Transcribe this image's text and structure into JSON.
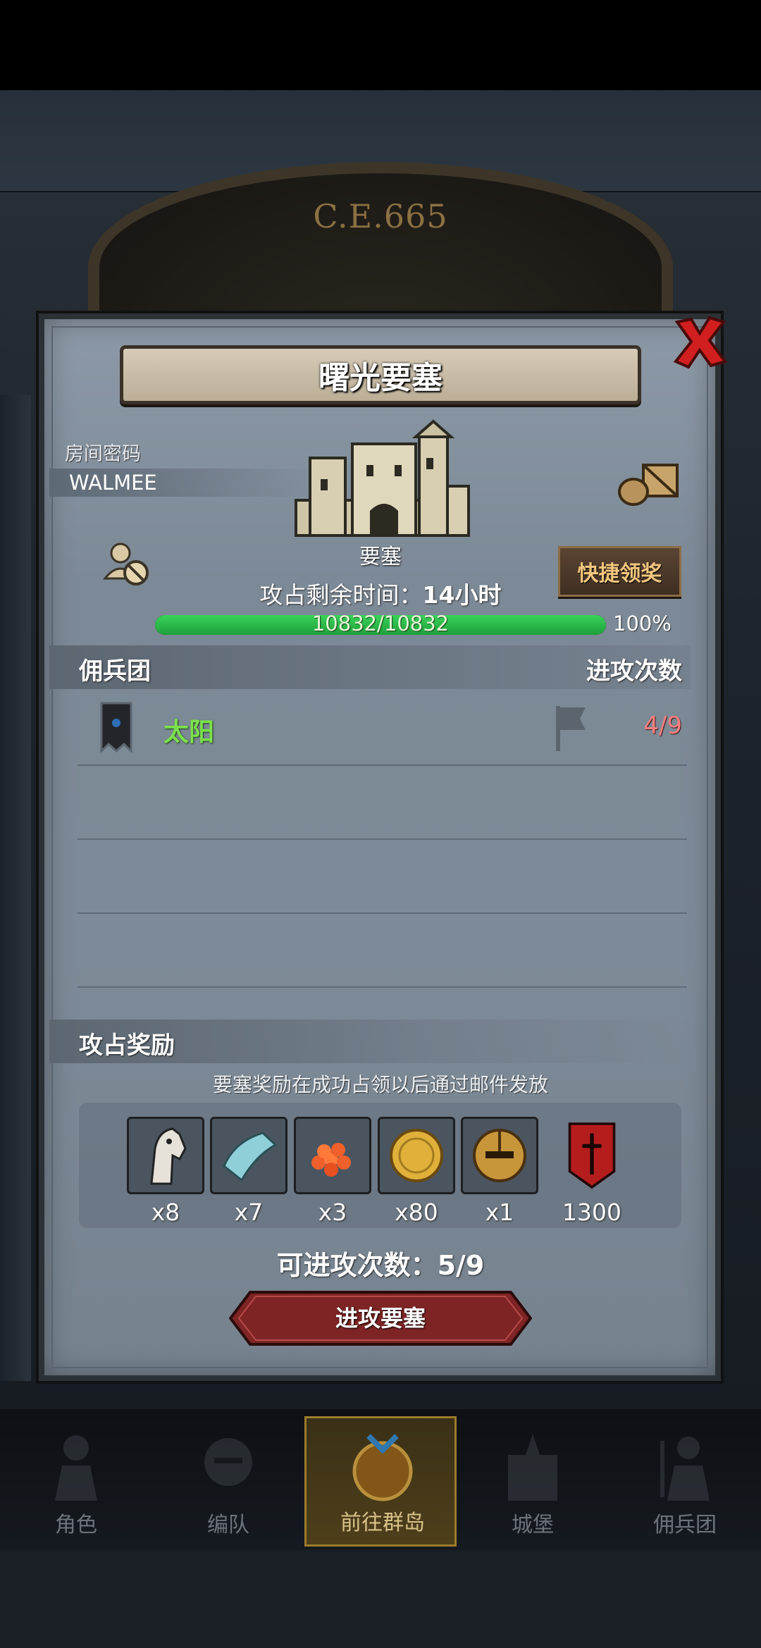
{
  "background": {
    "era_label": "C.E.665"
  },
  "modal": {
    "title": "曙光要塞",
    "room_password_label": "房间密码",
    "room_password": "WALMEE",
    "fortress_label": "要塞",
    "quick_claim": "快捷领奖",
    "timer_label": "攻占剩余时间：",
    "timer_value": "14小时",
    "hp_text": "10832/10832",
    "hp_percent": "100%",
    "hp_fraction": 1.0,
    "mercenary_header": "佣兵团",
    "attack_count_header": "进攻次数",
    "mercenaries": [
      {
        "name": "太阳",
        "count": "4/9"
      }
    ],
    "reward_header": "攻占奖励",
    "reward_note": "要塞奖励在成功占领以后通过邮件发放",
    "rewards": [
      {
        "icon": "horse-icon",
        "qty": "x8"
      },
      {
        "icon": "cloth-icon",
        "qty": "x7"
      },
      {
        "icon": "berries-icon",
        "qty": "x3"
      },
      {
        "icon": "gold-coin-icon",
        "qty": "x80"
      },
      {
        "icon": "helmet-icon",
        "qty": "x1"
      },
      {
        "icon": "red-banner-icon",
        "qty": "1300"
      }
    ],
    "attacks_left": "可进攻次数：5/9",
    "attack_button": "进攻要塞"
  },
  "nav": {
    "items": [
      {
        "label": "角色",
        "icon": "knight-icon"
      },
      {
        "label": "编队",
        "icon": "helmet-icon"
      },
      {
        "label": "前往群岛",
        "icon": "island-icon",
        "active": true
      },
      {
        "label": "城堡",
        "icon": "castle-icon"
      },
      {
        "label": "佣兵团",
        "icon": "mercenary-icon"
      }
    ]
  },
  "colors": {
    "accent_gold": "#f2c77d",
    "hp_green": "#2fbf4a",
    "merc_green": "#7be14c",
    "count_red": "#ff7f7f",
    "attack_btn_red": "#8a2a2a"
  }
}
